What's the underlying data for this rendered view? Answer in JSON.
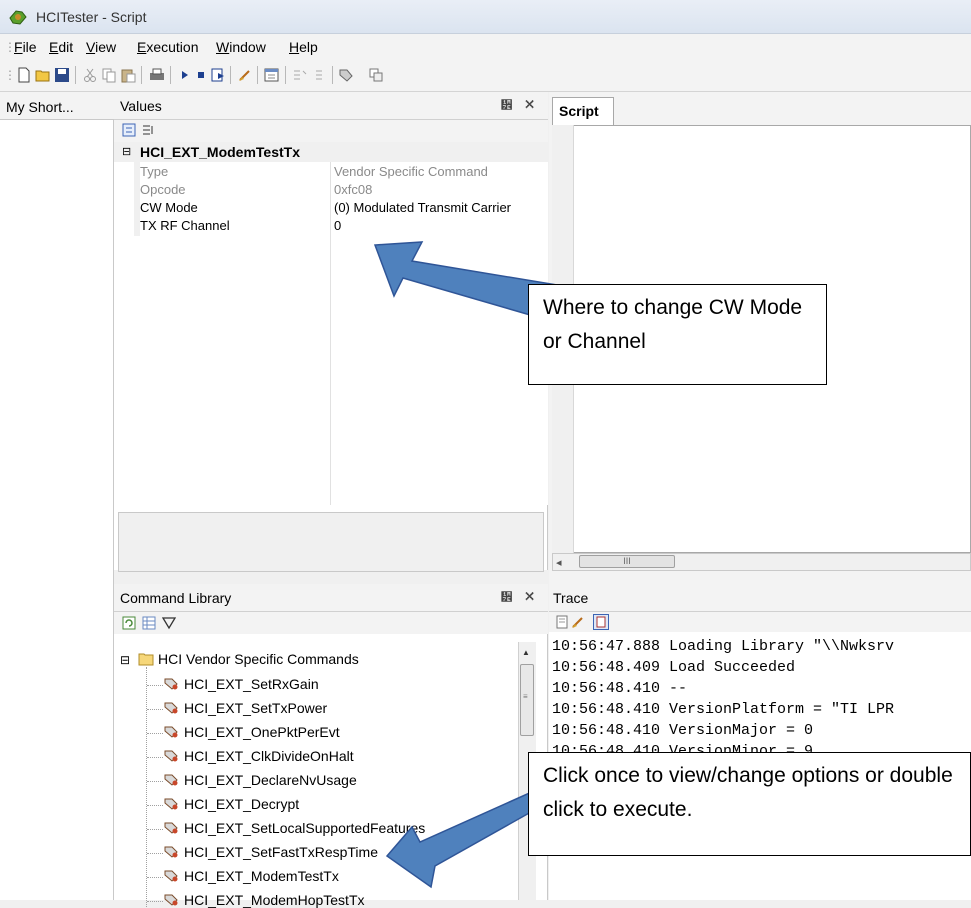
{
  "window": {
    "title": "HCITester - Script"
  },
  "menu": [
    "File",
    "Edit",
    "View",
    "Execution",
    "Window",
    "Help"
  ],
  "shortcuts": {
    "label": "My Short..."
  },
  "values_panel": {
    "title": "Values",
    "pin_close": "᩾ ✕",
    "category": "HCI_EXT_ModemTestTx",
    "rows": [
      {
        "name": "Type",
        "value": "Vendor Specific Command",
        "readonly": true
      },
      {
        "name": "Opcode",
        "value": "0xfc08",
        "readonly": true
      },
      {
        "name": "CW Mode",
        "value": "(0) Modulated Transmit Carrier",
        "readonly": false
      },
      {
        "name": "TX RF Channel",
        "value": "0",
        "readonly": false
      }
    ]
  },
  "script_panel": {
    "tab": "Script",
    "scroll_label": "III"
  },
  "command_library": {
    "title": "Command Library",
    "folder": "HCI Vendor Specific Commands",
    "items": [
      "HCI_EXT_SetRxGain",
      "HCI_EXT_SetTxPower",
      "HCI_EXT_OnePktPerEvt",
      "HCI_EXT_ClkDivideOnHalt",
      "HCI_EXT_DeclareNvUsage",
      "HCI_EXT_Decrypt",
      "HCI_EXT_SetLocalSupportedFeatures",
      "HCI_EXT_SetFastTxRespTime",
      "HCI_EXT_ModemTestTx",
      "HCI_EXT_ModemHopTestTx"
    ]
  },
  "trace": {
    "title": "Trace",
    "lines": [
      "10:56:47.888 Loading Library \"\\\\Nwksrv",
      "10:56:48.409 Load Succeeded",
      "10:56:48.410 --",
      "10:56:48.410 VersionPlatform = \"TI LPR",
      "10:56:48.410 VersionMajor = 0",
      "10:56:48.410 VersionMinor = 9"
    ]
  },
  "callouts": {
    "values": "Where to change CW Mode or Channel",
    "library": "Click once to view/change options or double click to execute."
  },
  "colors": {
    "arrow_fill": "#4f81bd",
    "arrow_stroke": "#2f5597"
  }
}
